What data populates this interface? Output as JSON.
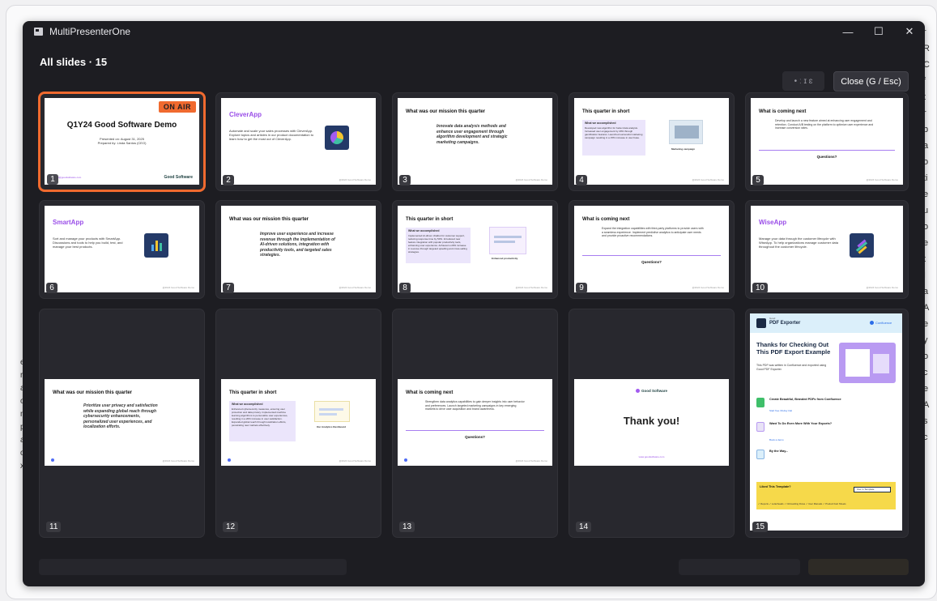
{
  "window": {
    "title": "MultiPresenterOne",
    "minimize": "—",
    "maximize": "☐",
    "close": "✕"
  },
  "header": {
    "heading": "All slides · 15",
    "blurred_button": "• ː ɪ ɛ",
    "close_button": "Close (G / Esc)"
  },
  "onair_badge": "ON AIR",
  "slides": [
    {
      "num": "1",
      "title": "Q1Y24 Good Software Demo",
      "line1": "Presented on: August 31, 2025",
      "line2": "Prepared by: Linda Santos (CEO)",
      "brand": "Good Software",
      "footer": "contact@goodsoftware.com"
    },
    {
      "num": "2",
      "title": "CleverApp",
      "body": "Automate and scale your sales processes with CleverApp. Explore topics and articles in our product documentation to learn how to get the most out of CleverApp.",
      "footer": "@2024 Good Software Demo"
    },
    {
      "num": "3",
      "title": "What was our mission this quarter",
      "body": "Innovate data analysis methods and enhance user engagement through algorithm development and strategic marketing campaigns.",
      "footer": "@2024 Good Software Demo"
    },
    {
      "num": "4",
      "title": "This quarter in short",
      "box_title": "What we accomplished",
      "body": "Developed new algorithm for better data analysis. Increased user engagement by 20% through gamification features. Launched successful marketing campaign resulting in a 15% increase in user base.",
      "caption": "Marketing campaign",
      "footer": "@2024 Good Software Demo"
    },
    {
      "num": "5",
      "title": "What is coming next",
      "body": "Develop and launch a new feature aimed at enhancing user engagement and retention. Conduct A/B testing on the platform to optimize user experience and increase conversion rates.",
      "question": "Questions?",
      "footer": "@2024 Good Software Demo"
    },
    {
      "num": "6",
      "title": "SmartApp",
      "body": "Sort and manage your products with SmartApp. Discussions and tools to help you build, test, and manage your best products.",
      "footer": "@2024 Good Software Demo"
    },
    {
      "num": "7",
      "title": "What was our mission this quarter",
      "body": "Improve user experience and increase revenue through the implementation of AI-driven solutions, integration with productivity tools, and targeted sales strategies.",
      "footer": "@2024 Good Software Demo"
    },
    {
      "num": "8",
      "title": "This quarter in short",
      "box_title": "What we accomplished",
      "body": "Implemented AI-driven chatbot for customer support, reducing response time by 50%. Introduced new feature integration with popular productivity tools, enhancing user experience. Achieved a 20% increase in revenue through targeted upselling and cross-selling strategies.",
      "caption": "Enhanced productivity",
      "footer": "@2024 Good Software Demo"
    },
    {
      "num": "9",
      "title": "What is coming next",
      "body": "Expand the integration capabilities with third-party platforms to provide users with a seamless experience. Implement predictive analytics to anticipate user needs and provide proactive recommendations.",
      "question": "Questions?",
      "footer": "@2024 Good Software Demo"
    },
    {
      "num": "10",
      "title": "WiseApp",
      "body": "Manage your data through the customer lifecycle with WiseApp. To help organizations manage customer data throughout the customer lifecycle.",
      "footer": "@2024 Good Software Demo"
    },
    {
      "num": "11",
      "title": "What was our mission this quarter",
      "body": "Prioritize user privacy and satisfaction while expanding global reach through cybersecurity enhancements, personalized user experiences, and localization efforts.",
      "footer": "@2024 Good Software Demo"
    },
    {
      "num": "12",
      "title": "This quarter in short",
      "box_title": "What we accomplished",
      "body": "Enhanced cybersecurity measures, ensuring user protection and data privacy. Implemented machine learning algorithms to personalize user experiences, resulting in a 20% increase in user satisfaction. Expanded global reach through localization efforts, penetrating new markets effectively.",
      "caption": "Our Analytics Dashboard",
      "footer": "@2024 Good Software Demo"
    },
    {
      "num": "13",
      "title": "What is coming next",
      "body": "Strengthen data analytics capabilities to gain deeper insights into user behavior and preferences. Launch targeted marketing campaigns in key emerging markets to drive user acquisition and brand awareness.",
      "question": "Questions?",
      "footer": "@2024 Good Software Demo"
    },
    {
      "num": "14",
      "brand": "Good Software",
      "title": "Thank you!",
      "footer": "www.goodsoftware.com"
    },
    {
      "num": "15",
      "logo_small": "Good",
      "logo": "PDF Exporter",
      "confluence": "Confluence",
      "title": "Thanks for Checking Out This PDF Export Example",
      "sub": "This PDF was written in Confluence and exported using Good PDF Exporter.",
      "f1_title": "Create Beautiful, Branded PDFs from Confluence",
      "f1_link": "Start free 30-day trial",
      "f2_title": "Want To Do Even More With Your Exports?",
      "f2_link": "Book a demo",
      "f3_title": "By the Way...",
      "cta_title": "Liked This Template?",
      "cta_btn": "Use in Template",
      "tags": "✓ Reports   ✓ Letterheads   ✓ Onboarding Flows   ✓ User Manuals   ✓ Product Fact Sheets"
    }
  ],
  "background": {
    "right_letters": [
      "r",
      "R",
      "C",
      "f",
      "t",
      "r",
      "b",
      "a",
      "o",
      "ti",
      "e",
      "u",
      "o",
      "e",
      "t",
      "I",
      "a",
      "A",
      "e",
      "y",
      "o",
      "c",
      "e",
      "A",
      "s",
      "c"
    ],
    "left_letters": [
      "e",
      "r",
      "a",
      "o",
      "n",
      "p",
      "a",
      "o",
      "x"
    ]
  }
}
